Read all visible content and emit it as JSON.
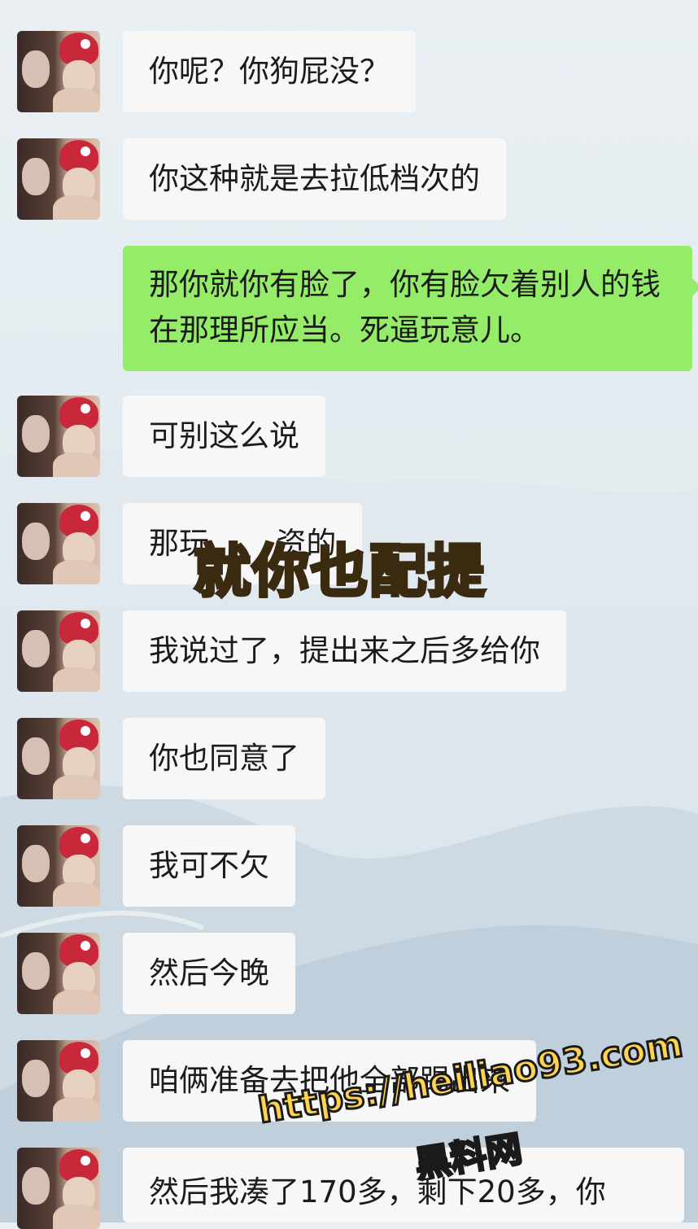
{
  "messages": [
    {
      "side": "received",
      "text": "你呢？你狗屁没？"
    },
    {
      "side": "received",
      "text": "你这种就是去拉低档次的"
    },
    {
      "side": "sent",
      "text": "那你就你有脸了，你有脸欠着别人的钱在那理所应当。死逼玩意儿。"
    },
    {
      "side": "received",
      "text": "可别这么说"
    },
    {
      "side": "received",
      "text": "那玩       资的"
    },
    {
      "side": "received",
      "text": "我说过了，提出来之后多给你"
    },
    {
      "side": "received",
      "text": "你也同意了"
    },
    {
      "side": "received",
      "text": "我可不欠"
    },
    {
      "side": "received",
      "text": "然后今晚"
    },
    {
      "side": "received",
      "text": "咱俩准备去把他全部踢出来"
    },
    {
      "side": "received",
      "text": "然后我凑了170多，剩下20多，你"
    }
  ],
  "overlay_caption": "就你也配提",
  "watermark": {
    "url": "https://heiliao93.com",
    "name": "黑料网"
  },
  "colors": {
    "sent_bubble": "#95ec69",
    "received_bubble": "#f7f7f7",
    "watermark": "#ffd34d"
  }
}
